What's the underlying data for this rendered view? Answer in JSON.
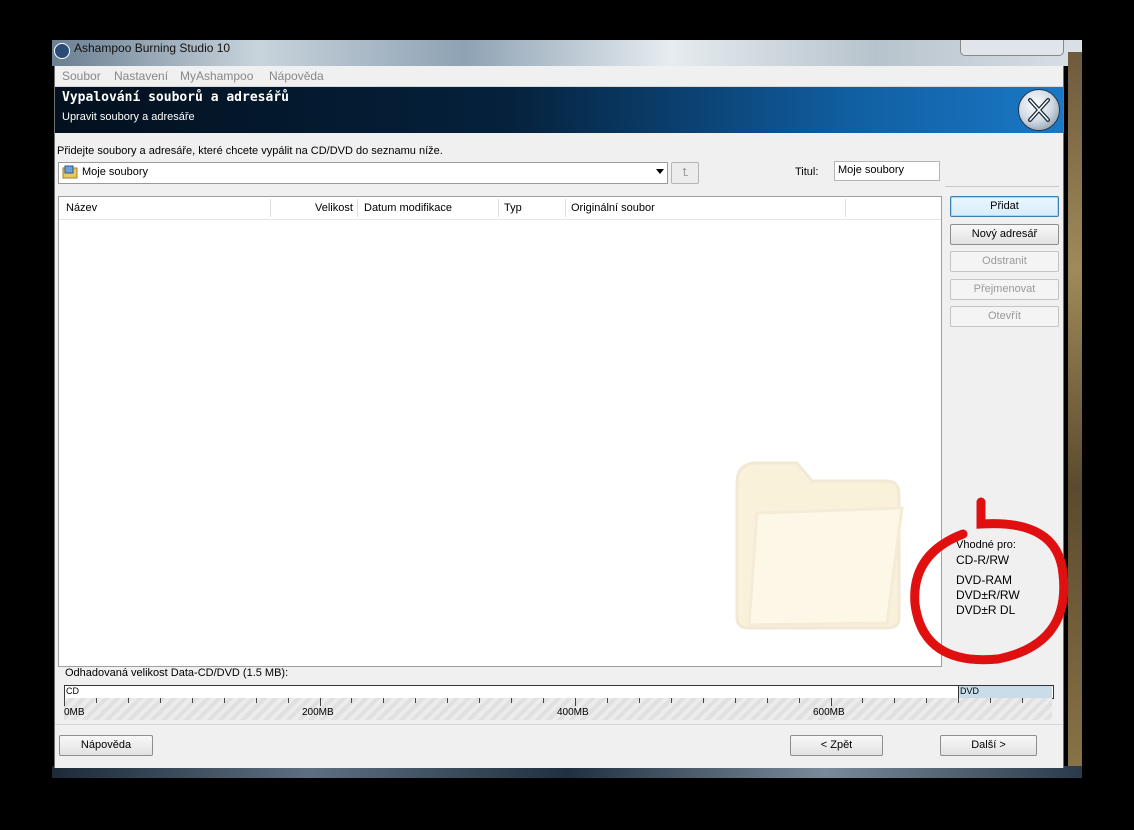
{
  "window": {
    "title": "Ashampoo Burning Studio 10"
  },
  "menu": [
    "Soubor",
    "Nastavení",
    "MyAshampoo",
    "Nápověda"
  ],
  "header": {
    "title": "Vypalování souborů a adresářů",
    "subtitle": "Upravit soubory a adresáře"
  },
  "instruction": "Přidejte soubory a adresáře, které chcete vypálit na CD/DVD do seznamu níže.",
  "location": {
    "value": "Moje soubory",
    "icon": "folder-computer-icon"
  },
  "titul": {
    "label": "Titul:",
    "value": "Moje soubory"
  },
  "columns": [
    "Název",
    "Velikost",
    "Datum modifikace",
    "Typ",
    "Originální soubor"
  ],
  "buttons": {
    "add": "Přidat",
    "new_folder": "Nový adresář",
    "remove": "Odstranit",
    "rename": "Přejmenovat",
    "open": "Otevřít"
  },
  "suitable": {
    "label": "Vhodné pro:",
    "items": [
      "CD-R/RW",
      "DVD-RAM",
      "DVD±R/RW",
      "DVD±R DL"
    ]
  },
  "size": {
    "label": "Odhadovaná velikost Data-CD/DVD (1.5 MB):",
    "cd_label": "CD",
    "dvd_label": "DVD",
    "scale_labels": [
      "0MB",
      "200MB",
      "400MB",
      "600MB"
    ]
  },
  "footer": {
    "help": "Nápověda",
    "back": "< Zpět",
    "next": "Další >"
  },
  "colors": {
    "header_dark": "#03101e",
    "header_light": "#1a78c4",
    "annotation": "#e01010"
  }
}
